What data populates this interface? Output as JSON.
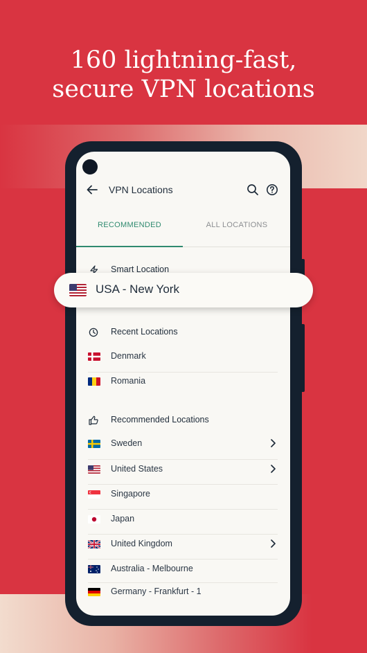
{
  "headline": {
    "line1": "160 lightning-fast,",
    "line2": "secure VPN locations"
  },
  "appbar": {
    "title": "VPN Locations",
    "icons": [
      "back-arrow-icon",
      "search-icon",
      "help-icon"
    ]
  },
  "tabs": [
    {
      "label": "RECOMMENDED",
      "active": true
    },
    {
      "label": "ALL LOCATIONS",
      "active": false
    }
  ],
  "smart_location": {
    "label": "Smart Location",
    "icon": "lightning-icon"
  },
  "selected_location": {
    "label": "USA - New York",
    "flag": "us"
  },
  "recent": {
    "header": "Recent Locations",
    "icon": "clock-icon",
    "items": [
      {
        "label": "Denmark",
        "flag": "dk"
      },
      {
        "label": "Romania",
        "flag": "ro"
      }
    ]
  },
  "recommended": {
    "header": "Recommended Locations",
    "icon": "thumbs-up-icon",
    "items": [
      {
        "label": "Sweden",
        "flag": "se",
        "chevron": true
      },
      {
        "label": "United States",
        "flag": "us",
        "chevron": true
      },
      {
        "label": "Singapore",
        "flag": "sg",
        "chevron": false
      },
      {
        "label": "Japan",
        "flag": "jp",
        "chevron": false
      },
      {
        "label": "United Kingdom",
        "flag": "gb",
        "chevron": true
      },
      {
        "label": "Australia - Melbourne",
        "flag": "au",
        "chevron": false
      },
      {
        "label": "Germany - Frankfurt - 1",
        "flag": "de",
        "chevron": false
      }
    ]
  },
  "colors": {
    "brand_red": "#d93441",
    "phone_frame": "#14202e",
    "screen_bg": "#f9f8f4",
    "accent_green": "#2f8a6f"
  }
}
